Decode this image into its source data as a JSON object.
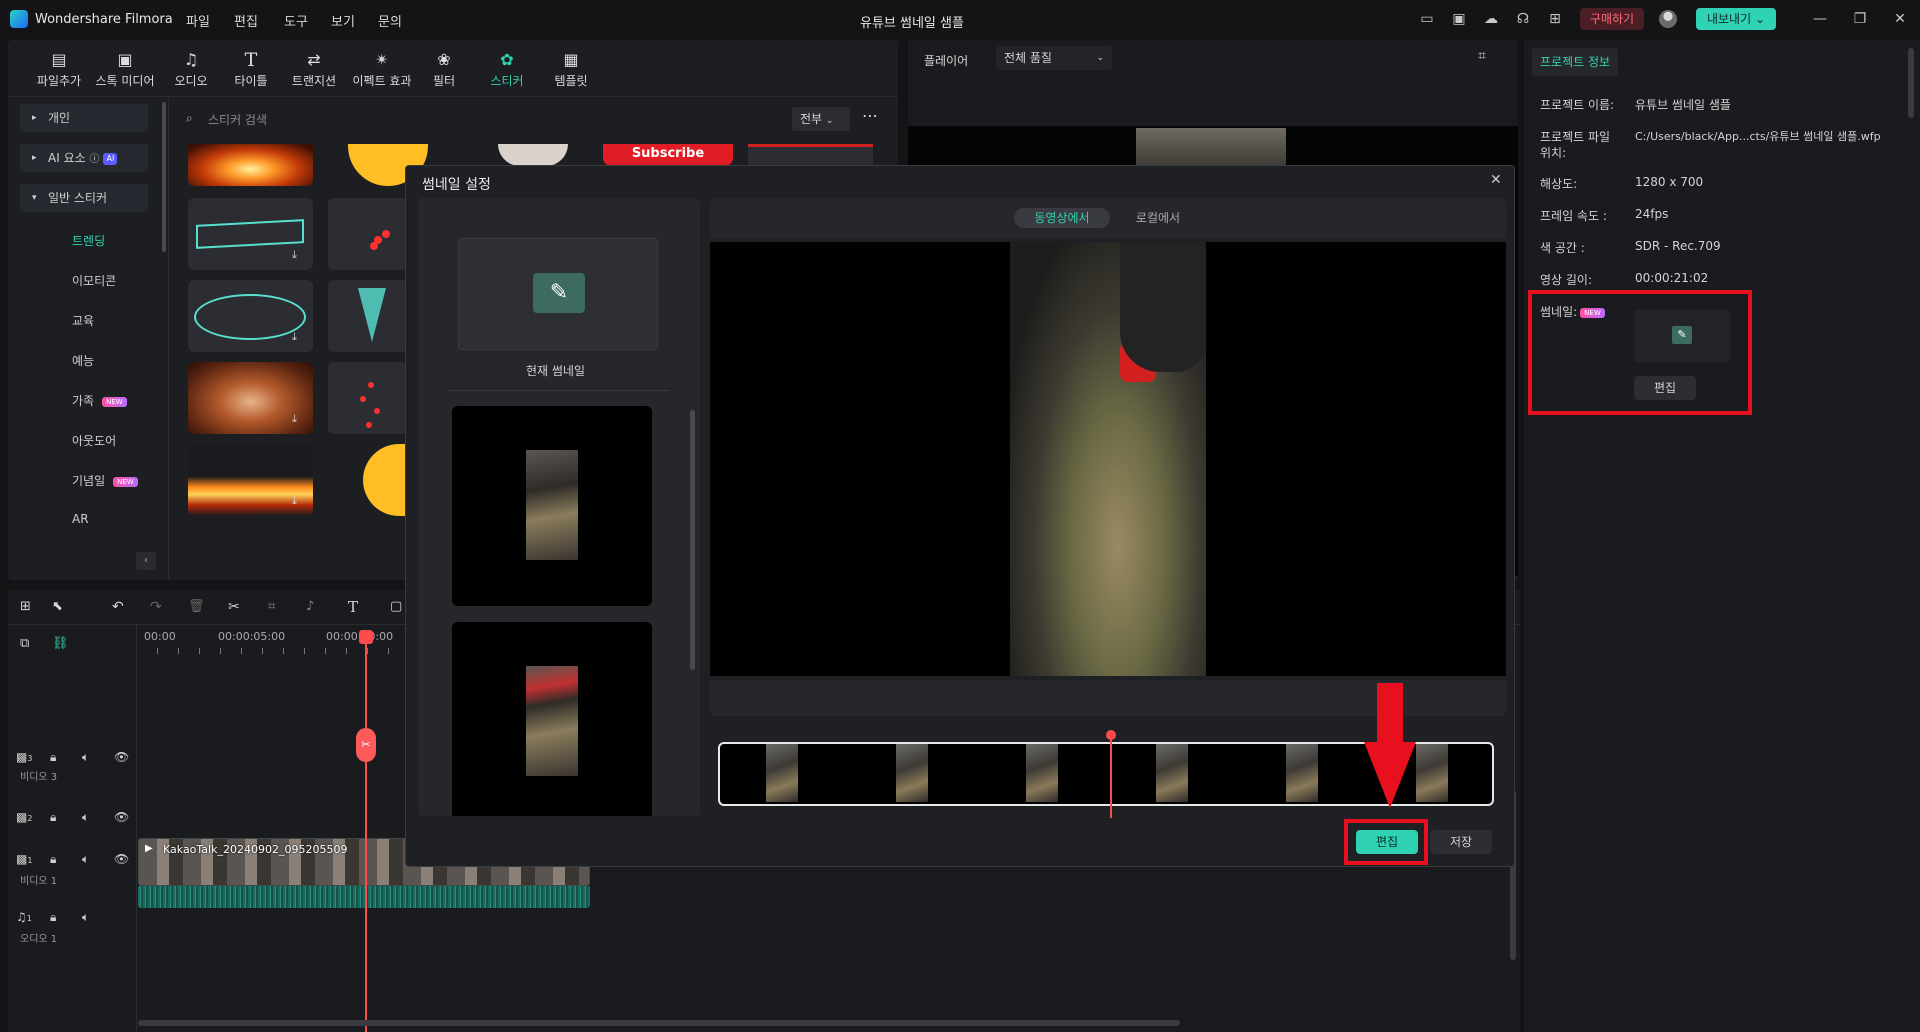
{
  "app": {
    "name": "Wondershare Filmora",
    "project_title": "유튜브 썸네일 샘플"
  },
  "menu": [
    "파일",
    "편집",
    "도구",
    "보기",
    "문의"
  ],
  "header": {
    "purchase_label": "구매하기",
    "export_label": "내보내기"
  },
  "toolbar": {
    "items": [
      {
        "label": "파일추가",
        "icon": "import-icon"
      },
      {
        "label": "스톡 미디어",
        "icon": "stock-media-icon"
      },
      {
        "label": "오디오",
        "icon": "music-note-icon"
      },
      {
        "label": "타이틀",
        "icon": "title-t-icon"
      },
      {
        "label": "트랜지션",
        "icon": "transition-icon"
      },
      {
        "label": "이펙트 효과",
        "icon": "effects-icon"
      },
      {
        "label": "필터",
        "icon": "filter-icon"
      },
      {
        "label": "스티커",
        "icon": "sticker-icon",
        "active": true
      },
      {
        "label": "템플릿",
        "icon": "template-icon"
      }
    ]
  },
  "sidebar": {
    "groups": [
      {
        "label": "개인"
      },
      {
        "label": "AI 요소",
        "badge": "AI"
      },
      {
        "label": "일반 스티커",
        "expanded": true
      }
    ],
    "sub_items": [
      {
        "label": "트렌딩",
        "active": true,
        "new": false
      },
      {
        "label": "이모티콘",
        "new": false
      },
      {
        "label": "교육",
        "new": false
      },
      {
        "label": "예능",
        "new": false
      },
      {
        "label": "가족",
        "new": true
      },
      {
        "label": "아웃도어",
        "new": false
      },
      {
        "label": "기념일",
        "new": true
      },
      {
        "label": "AR",
        "new": false
      }
    ],
    "new_badge": "NEW"
  },
  "sticker_search": {
    "placeholder": "스티커 검색",
    "filter_value": "전부"
  },
  "sticker_text": "Subscribe",
  "player": {
    "label": "플레이어",
    "quality": "전체 품질"
  },
  "project_info": {
    "tab": "프로젝트 정보",
    "name_label": "프로젝트 이름:",
    "name_value": "유튜브 썸네일 샘플",
    "file_label_1": "프로젝트 파일",
    "file_label_2": "위치:",
    "file_value": "C:/Users/black/App...cts/유튜브 썸네일 샘플.wfp",
    "resolution_label": "해상도:",
    "resolution_value": "1280 x 700",
    "framerate_label": "프레임 속도 :",
    "framerate_value": "24fps",
    "colorspace_label": "색 공간 :",
    "colorspace_value": "SDR - Rec.709",
    "duration_label": "영상 길이:",
    "duration_value": "00:00:21:02",
    "thumbnail_label": "썸네일:",
    "thumbnail_badge": "NEW",
    "edit_label": "편집"
  },
  "dialog": {
    "title": "썸네일 설정",
    "current_thumbnail_label": "현재 썸네일",
    "tabs": [
      "동영상에서",
      "로컬에서"
    ],
    "active_tab": 0,
    "edit_button": "편집",
    "save_button": "저장"
  },
  "timeline": {
    "timecodes": [
      "00:00",
      "00:00:05:00",
      "00:00:10:00"
    ],
    "clip_name": "KakaoTalk_20240902_095205509",
    "tracks": [
      {
        "num": "3",
        "label": "비디오 3"
      },
      {
        "num": "2",
        "label": ""
      },
      {
        "num": "1",
        "label": "비디오 1"
      },
      {
        "num": "1",
        "label": "오디오 1"
      }
    ]
  },
  "colors": {
    "accent": "#33d1b0",
    "highlight_red": "#e8101e",
    "playhead": "#ff4b4b"
  }
}
